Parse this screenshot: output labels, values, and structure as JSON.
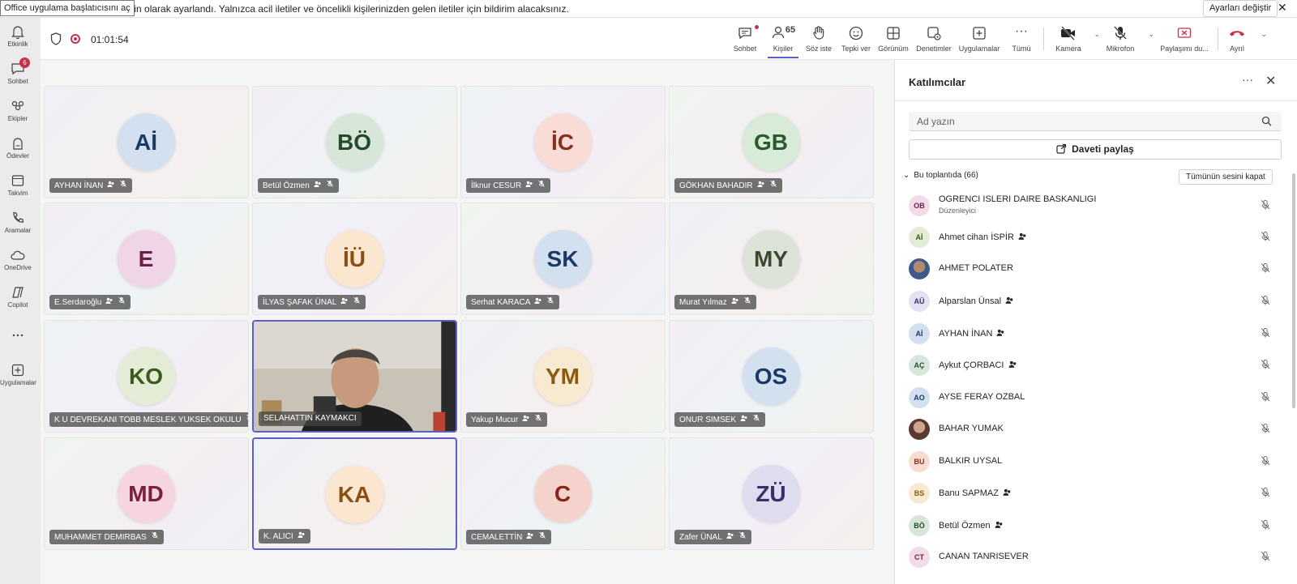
{
  "banner": {
    "tooltip": "Office uygulama başlatıcısını aç",
    "message": "neyin olarak ayarlandı. Yalnızca acil iletiler ve öncelikli kişilerinizden gelen iletiler için bildirim alacaksınız.",
    "settings_label": "Ayarları değiştir"
  },
  "rail": [
    {
      "label": "Etkinlik",
      "icon": "bell-icon"
    },
    {
      "label": "Sohbet",
      "icon": "chat-icon",
      "badge": "6"
    },
    {
      "label": "Ekipler",
      "icon": "teams-icon"
    },
    {
      "label": "Ödevler",
      "icon": "assignments-icon"
    },
    {
      "label": "Takvim",
      "icon": "calendar-icon"
    },
    {
      "label": "Aramalar",
      "icon": "phone-icon"
    },
    {
      "label": "OneDrive",
      "icon": "onedrive-icon"
    },
    {
      "label": "Copilot",
      "icon": "copilot-icon"
    },
    {
      "label": "...",
      "icon": "more-icon"
    },
    {
      "label": "Uygulamalar",
      "icon": "add-apps-icon"
    }
  ],
  "toolbar": {
    "timer": "01:01:54",
    "chat": "Sohbet",
    "people": "Kişiler",
    "people_count": "65",
    "raise": "Söz iste",
    "react": "Tepki ver",
    "view": "Görünüm",
    "controls": "Denetimler",
    "apps": "Uygulamalar",
    "more": "Tümü",
    "camera": "Kamera",
    "mic": "Mikrofon",
    "share": "Paylaşımı du...",
    "leave": "Ayrıl"
  },
  "tiles": [
    {
      "initials": "Aİ",
      "name": "AYHAN İNAN",
      "bg": "#d3e0ef",
      "fg": "#1b3a63"
    },
    {
      "initials": "BÖ",
      "name": "Betül Özmen",
      "bg": "#d7e6d9",
      "fg": "#244a2c"
    },
    {
      "initials": "İC",
      "name": "İlknur CESUR",
      "bg": "#f9dcd5",
      "fg": "#8a2f1f"
    },
    {
      "initials": "GB",
      "name": "GÖKHAN BAHADIR",
      "bg": "#d8ead8",
      "fg": "#2a5a2e"
    },
    {
      "initials": "E",
      "name": "E.Serdaroğlu",
      "bg": "#efd5e6",
      "fg": "#6b1f4d"
    },
    {
      "initials": "İÜ",
      "name": "İLYAS ŞAFAK ÜNAL",
      "bg": "#fbe6cf",
      "fg": "#8a4f12"
    },
    {
      "initials": "SK",
      "name": "Serhat KARACA",
      "bg": "#d3e0ef",
      "fg": "#1b3a63"
    },
    {
      "initials": "MY",
      "name": "Murat Yılmaz",
      "bg": "#dde3d8",
      "fg": "#394a2f"
    },
    {
      "initials": "KO",
      "name": "K U DEVREKANI TOBB MESLEK YUKSEK OKULU",
      "bg": "#e4ecd6",
      "fg": "#3b5a1e"
    },
    {
      "initials": "",
      "name": "SELAHATTIN KAYMAKCI",
      "video": true
    },
    {
      "initials": "YM",
      "name": "Yakup Mucur",
      "bg": "#f8ead0",
      "fg": "#8a5a10"
    },
    {
      "initials": "OS",
      "name": "ONUR SIMSEK",
      "bg": "#d3e0ef",
      "fg": "#1b3a63"
    },
    {
      "initials": "MD",
      "name": "MUHAMMET DEMIRBAS",
      "bg": "#f6d5e0",
      "fg": "#7a1f3d"
    },
    {
      "initials": "KA",
      "name": "K. ALICI",
      "bg": "#fbe6cf",
      "fg": "#8a4f12"
    },
    {
      "initials": "C",
      "name": "CEMALETTİN",
      "bg": "#f5d3cc",
      "fg": "#8a2419"
    },
    {
      "initials": "ZÜ",
      "name": "Zafer ÜNAL",
      "bg": "#e0dcef",
      "fg": "#3a2f6b"
    }
  ],
  "panel": {
    "title": "Katılımcılar",
    "search_placeholder": "Ad yazın",
    "share_invite": "Daveti paylaş",
    "section": "Bu toplantıda (66)",
    "mute_all": "Tümünün sesini kapat",
    "participants": [
      {
        "initials": "OB",
        "name": "OGRENCI ISLERI DAIRE BASKANLIGI",
        "role": "Düzenleyici",
        "bg": "#f3dbe8",
        "fg": "#6b1f4d"
      },
      {
        "initials": "Aİ",
        "name": "Ahmet cihan İSPİR",
        "bg": "#e4ecd6",
        "fg": "#3b5a1e",
        "extra": true
      },
      {
        "initials": "",
        "name": "AHMET POLATER",
        "photo": true
      },
      {
        "initials": "AÜ",
        "name": "Alparslan Ünsal",
        "bg": "#e6e0f2",
        "fg": "#3a2f6b",
        "extra": true
      },
      {
        "initials": "Aİ",
        "name": "AYHAN İNAN",
        "bg": "#d3e0ef",
        "fg": "#1b3a63",
        "extra": true
      },
      {
        "initials": "AÇ",
        "name": "Aykut ÇORBACI",
        "bg": "#d8e6dc",
        "fg": "#244a2c",
        "extra": true
      },
      {
        "initials": "AO",
        "name": "AYSE FERAY OZBAL",
        "bg": "#d3e0ef",
        "fg": "#1b3a63"
      },
      {
        "initials": "",
        "name": "BAHAR YUMAK",
        "photo": true
      },
      {
        "initials": "BU",
        "name": "BALKIR UYSAL",
        "bg": "#f8dcd2",
        "fg": "#8a2f1f"
      },
      {
        "initials": "BS",
        "name": "Banu SAPMAZ",
        "bg": "#f8ead0",
        "fg": "#8a5a10",
        "extra": true
      },
      {
        "initials": "BÖ",
        "name": "Betül Özmen",
        "bg": "#d7e6d9",
        "fg": "#244a2c",
        "extra": true
      },
      {
        "initials": "CT",
        "name": "CANAN TANRISEVER",
        "bg": "#f3dbe8",
        "fg": "#6b1f4d"
      }
    ]
  }
}
